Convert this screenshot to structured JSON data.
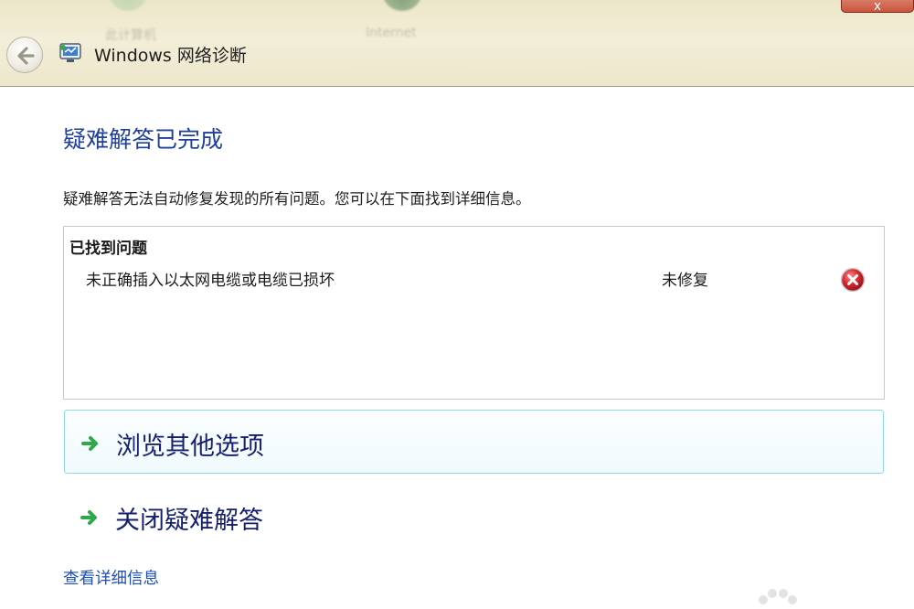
{
  "window": {
    "title": "Windows 网络诊断",
    "close_label": "x",
    "background_labels": [
      "此计算机",
      "Internet"
    ]
  },
  "content": {
    "heading": "疑难解答已完成",
    "description": "疑难解答无法自动修复发现的所有问题。您可以在下面找到详细信息。",
    "problems": {
      "heading": "已找到问题",
      "items": [
        {
          "name": "未正确插入以太网电缆或电缆已损坏",
          "status": "未修复",
          "status_icon": "error-icon"
        }
      ]
    },
    "options": [
      {
        "label": "浏览其他选项",
        "icon": "green-arrow-icon"
      },
      {
        "label": "关闭疑难解答",
        "icon": "green-arrow-icon"
      }
    ],
    "details_link": "查看详细信息"
  },
  "colors": {
    "heading": "#1f3f9b",
    "link": "#1a4fc0",
    "option_text": "#141f6e",
    "option_highlight_border": "#8fd7eb",
    "error_red": "#d4262d",
    "arrow_green": "#2fa84a"
  }
}
